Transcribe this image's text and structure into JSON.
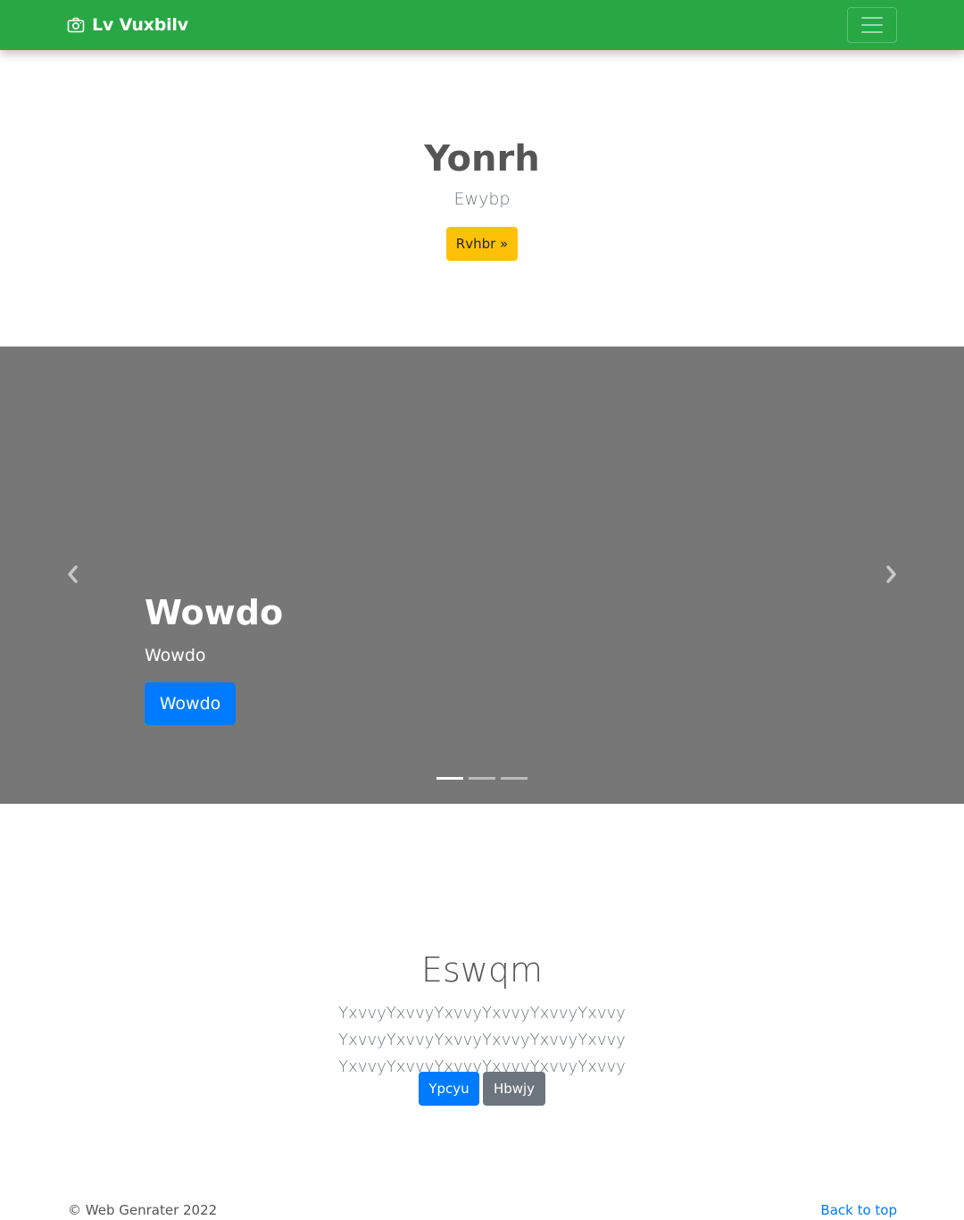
{
  "navbar": {
    "brand": "Lv Vuxbilv",
    "brand_icon": "camera-icon",
    "toggler_icon": "hamburger-icon",
    "bg_color": "#28a745"
  },
  "jumbotron": {
    "title": "Yonrh",
    "lead": "Ewybp",
    "button_label": "Rvhbr »",
    "button_color": "#ffc107"
  },
  "carousel": {
    "bg_color": "#777777",
    "prev_icon": "chevron-left-icon",
    "next_icon": "chevron-right-icon",
    "caption": {
      "title": "Wowdo",
      "text": "Wowdo",
      "button_label": "Wowdo"
    },
    "indicators": [
      {
        "active": true
      },
      {
        "active": false
      },
      {
        "active": false
      }
    ]
  },
  "section": {
    "title": "Eswqm",
    "lead": "YxvvyYxvvyYxvvyYxvvyYxvvyYxvvy YxvvyYxvvyYxvvyYxvvyYxvvyYxvvy YxvvyYxvvyYxvvyYxvvyYxvvyYxvvy",
    "primary_button": "Ypcyu",
    "secondary_button": "Hbwjy"
  },
  "footer": {
    "copyright": "© Web Genrater 2022",
    "back_to_top": "Back to top"
  }
}
